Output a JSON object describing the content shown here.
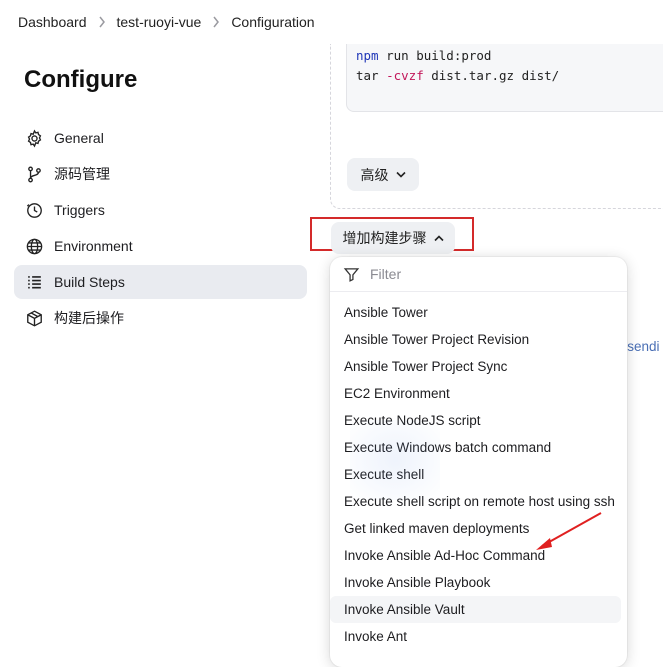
{
  "breadcrumb": {
    "items": [
      "Dashboard",
      "test-ruoyi-vue",
      "Configuration"
    ]
  },
  "sidebar": {
    "title": "Configure",
    "items": [
      {
        "label": "General",
        "icon": "gear-icon",
        "active": false
      },
      {
        "label": "源码管理",
        "icon": "branch-icon",
        "active": false
      },
      {
        "label": "Triggers",
        "icon": "clock-icon",
        "active": false
      },
      {
        "label": "Environment",
        "icon": "globe-icon",
        "active": false
      },
      {
        "label": "Build Steps",
        "icon": "list-icon",
        "active": true
      },
      {
        "label": "构建后操作",
        "icon": "package-icon",
        "active": false
      }
    ]
  },
  "main": {
    "code": {
      "line1_cmd": "npm",
      "line1_rest": " run build:prod",
      "line2_cmd": "tar",
      "line2_flag": " -cvzf",
      "line2_rest": " dist.tar.gz dist/"
    },
    "advanced_label": "高级",
    "add_step_label": "增加构建步骤",
    "background_link_text": "e sendi"
  },
  "dropdown": {
    "filter_placeholder": "Filter",
    "options": [
      "Ansible Tower",
      "Ansible Tower Project Revision",
      "Ansible Tower Project Sync",
      "EC2 Environment",
      "Execute NodeJS script",
      "Execute Windows batch command",
      "Execute shell",
      "Execute shell script on remote host using ssh",
      "Get linked maven deployments",
      "Invoke Ansible Ad-Hoc Command",
      "Invoke Ansible Playbook",
      "Invoke Ansible Vault",
      "Invoke Ant"
    ],
    "hovered_index": 11
  },
  "colors": {
    "highlight_box": "#d42a2a",
    "annotation_arrow": "#e02020",
    "active_nav_bg": "#e9ebf0"
  }
}
